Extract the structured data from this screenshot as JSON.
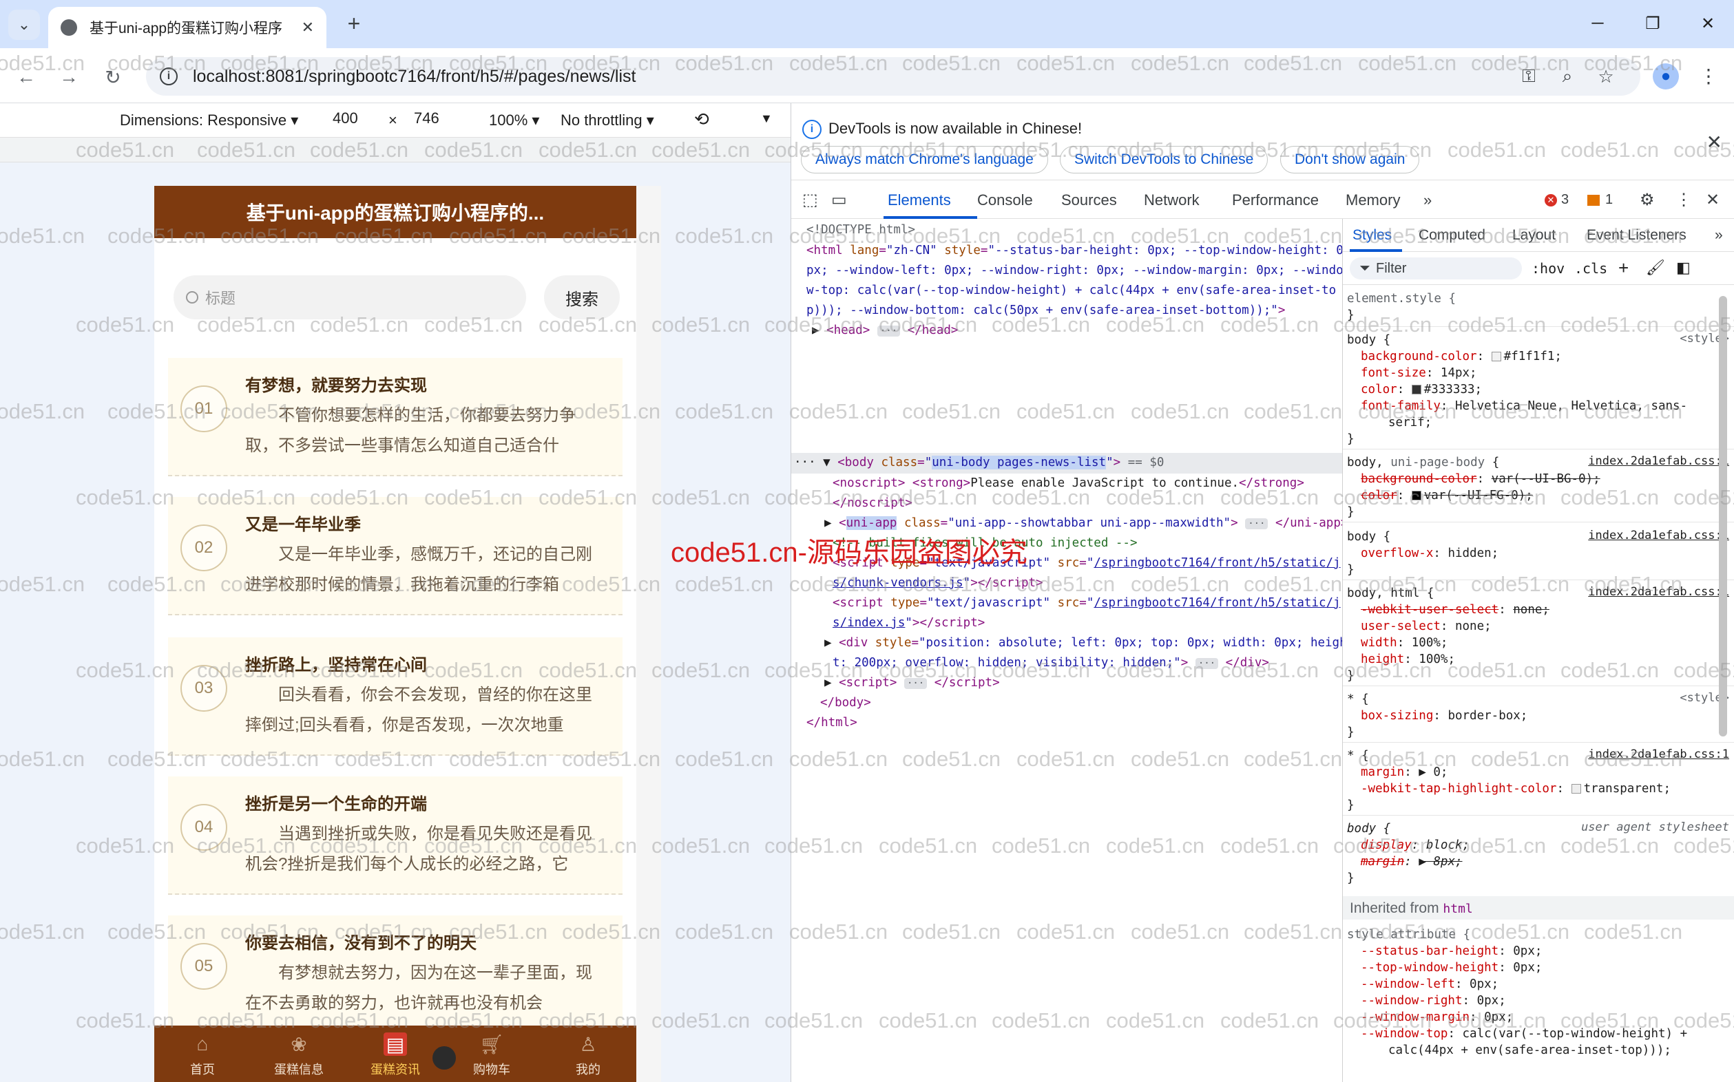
{
  "browser": {
    "tab_title": "基于uni-app的蛋糕订购小程序",
    "url": "localhost:8081/springbootc7164/front/h5/#/pages/news/list",
    "close_glyph": "✕",
    "newtab_glyph": "+"
  },
  "device_toolbar": {
    "dimensions_label": "Dimensions: Responsive ▾",
    "width": "400",
    "times": "×",
    "height": "746",
    "zoom": "100% ▾",
    "throttling": "No throttling ▾"
  },
  "app": {
    "header_title": "基于uni-app的蛋糕订购小程序的...",
    "search_placeholder": "标题",
    "search_button": "搜索",
    "news": [
      {
        "num": "01",
        "title": "有梦想，就要努力去实现",
        "desc": "不管你想要怎样的生活，你都要去努力争取，不多尝试一些事情怎么知道自己适合什"
      },
      {
        "num": "02",
        "title": "又是一年毕业季",
        "desc": "又是一年毕业季，感慨万千，还记的自己刚进学校那时候的情景，我拖着沉重的行李箱"
      },
      {
        "num": "03",
        "title": "挫折路上，坚持常在心间",
        "desc": "回头看看，你会不会发现，曾经的你在这里摔倒过;回头看看，你是否发现，一次次地重"
      },
      {
        "num": "04",
        "title": "挫折是另一个生命的开端",
        "desc": "当遇到挫折或失败，你是看见失败还是看见机会?挫折是我们每个人成长的必经之路，它"
      },
      {
        "num": "05",
        "title": "你要去相信，没有到不了的明天",
        "desc": "有梦想就去努力，因为在这一辈子里面，现在不去勇敢的努力，也许就再也没有机会"
      }
    ],
    "tabbar": [
      "首页",
      "蛋糕信息",
      "蛋糕资讯",
      "购物车",
      "我的"
    ]
  },
  "devtools": {
    "banner_message": "DevTools is now available in Chinese!",
    "banner_buttons": [
      "Always match Chrome's language",
      "Switch DevTools to Chinese",
      "Don't show again"
    ],
    "tabs": [
      "Elements",
      "Console",
      "Sources",
      "Network",
      "Performance",
      "Memory"
    ],
    "more_tabs": "»",
    "errors": "3",
    "warnings": "1",
    "styles_tabs": [
      "Styles",
      "Computed",
      "Layout",
      "Event Listeners",
      "»"
    ],
    "filter_placeholder": "Filter",
    "hov": ":hov",
    "cls": ".cls",
    "inherited_label": "Inherited from",
    "inherited_tag": "html"
  },
  "watermark": {
    "text": "code51.cn",
    "red_text": "code51.cn-源码乐园盗图必究"
  }
}
